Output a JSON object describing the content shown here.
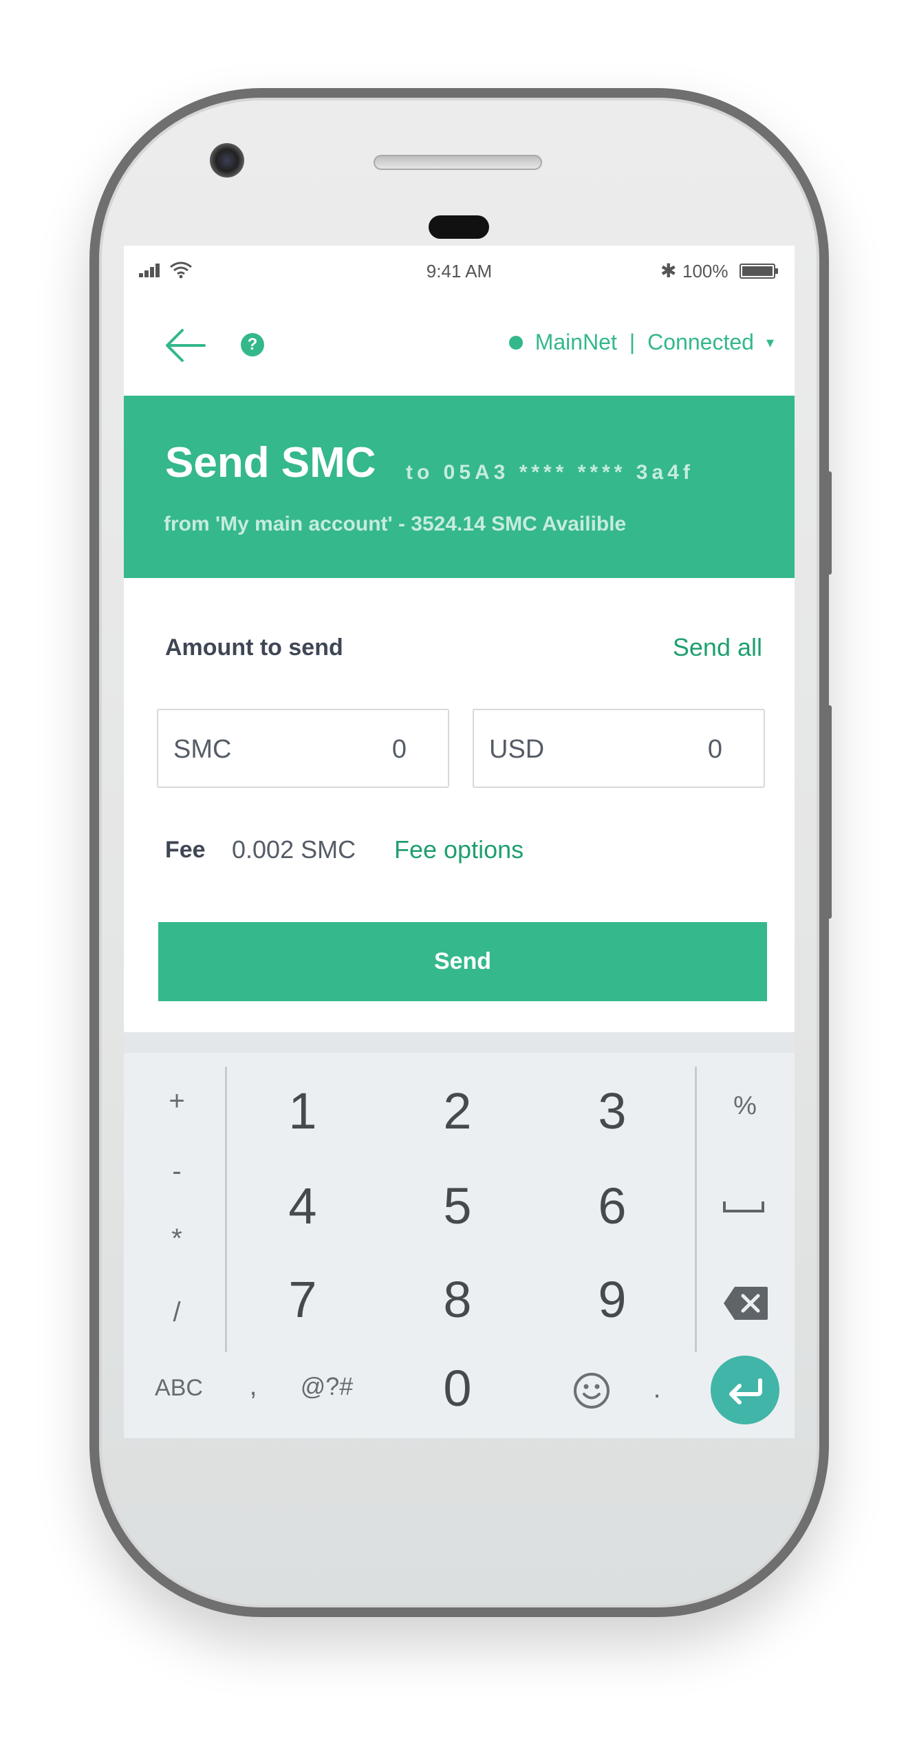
{
  "status_bar": {
    "time": "9:41 AM",
    "battery": "100%"
  },
  "app_bar": {
    "network": "MainNet",
    "separator": "|",
    "status": "Connected",
    "caret": "▾",
    "help": "?"
  },
  "header": {
    "title": "Send SMC",
    "to": "to 05A3 **** **** 3a4f",
    "from": "from 'My main account' - 3524.14 SMC Availible"
  },
  "form": {
    "amount_label": "Amount to send",
    "send_all": "Send all",
    "smc_currency": "SMC",
    "smc_value": "0",
    "usd_currency": "USD",
    "usd_value": "0",
    "fee_label": "Fee",
    "fee_value": "0.002 SMC",
    "fee_options": "Fee options",
    "send_button": "Send"
  },
  "keyboard": {
    "left": [
      "+",
      "-",
      "*",
      "/"
    ],
    "digits": [
      "1",
      "2",
      "3",
      "4",
      "5",
      "6",
      "7",
      "8",
      "9",
      "0"
    ],
    "right_percent": "%",
    "abc": "ABC",
    "comma": ",",
    "symbols": "@?#",
    "period": "."
  },
  "colors": {
    "accent": "#35b88b",
    "link": "#1e9f6e",
    "enter": "#41b5a8"
  }
}
